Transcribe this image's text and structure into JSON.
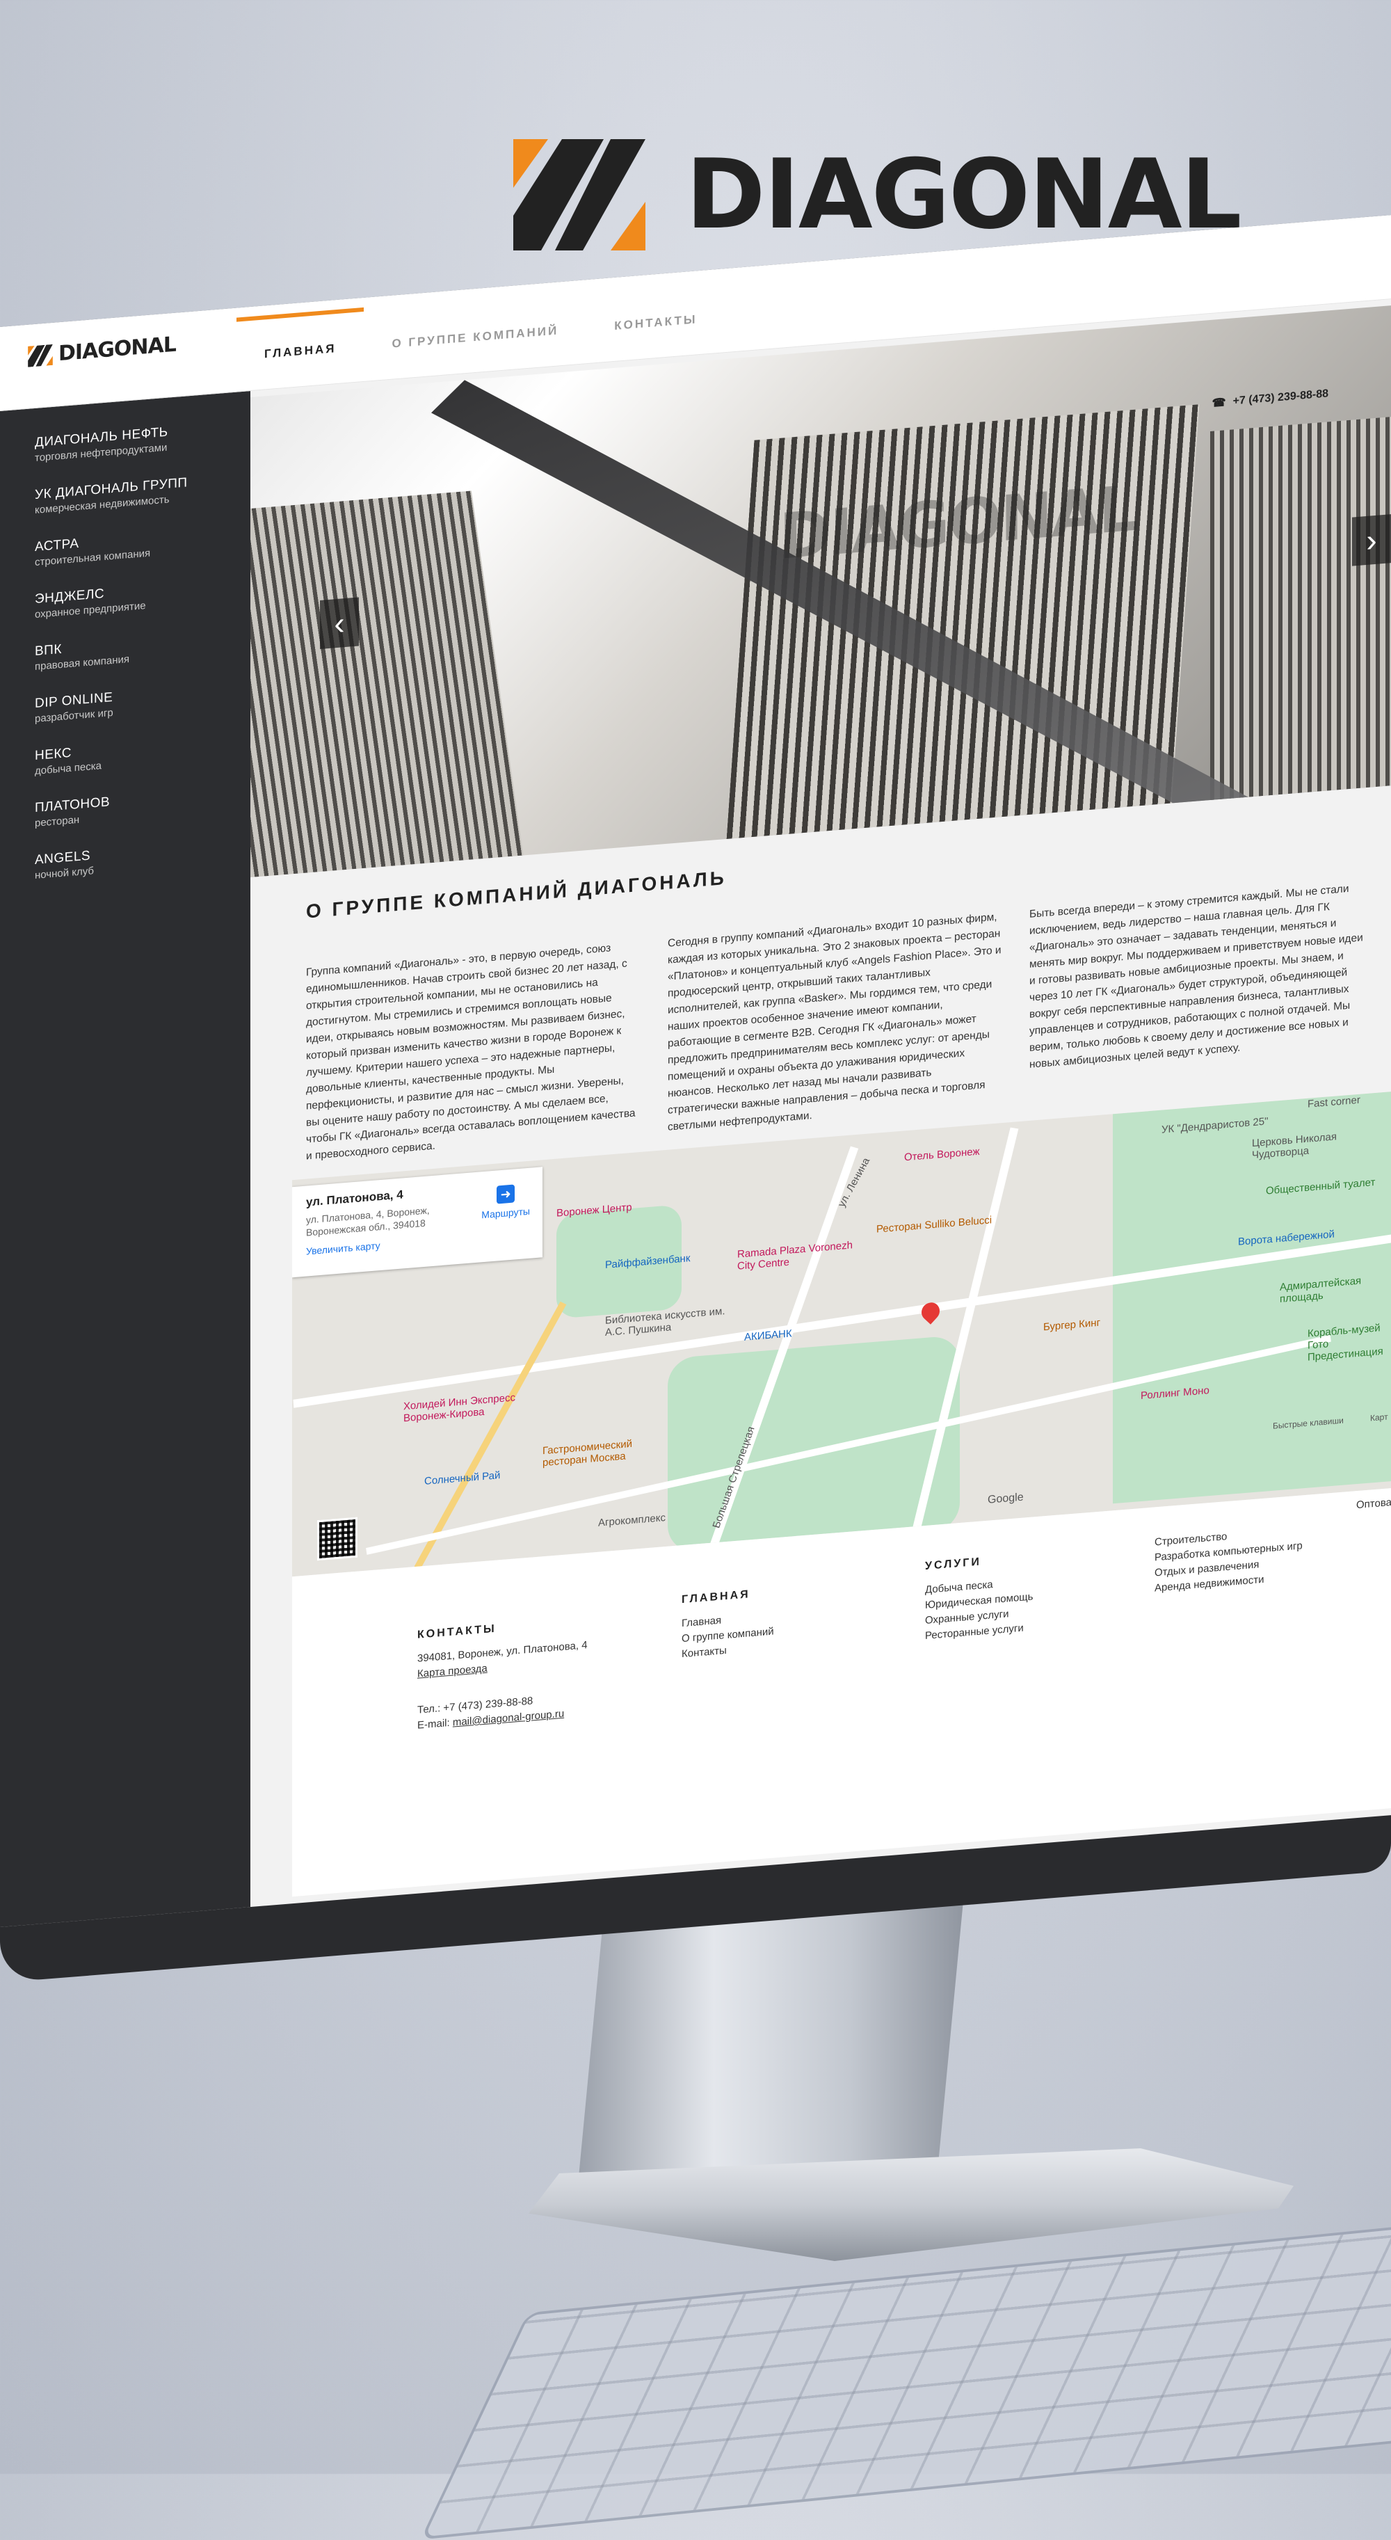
{
  "brand": {
    "name": "DIAGONAL",
    "accent": "#f08a1c"
  },
  "site": {
    "logo_text": "DIAGONAL",
    "nav": [
      {
        "label": "Главная"
      },
      {
        "label": "О группе компаний"
      },
      {
        "label": "Контакты"
      }
    ],
    "phone": "+7 (473) 239-88-88"
  },
  "sidebar": {
    "items": [
      {
        "title": "ДИАГОНАЛЬ НЕФТЬ",
        "subtitle": "торговля нефтепродуктами"
      },
      {
        "title": "УК ДИАГОНАЛЬ ГРУПП",
        "subtitle": "комерческая недвижимость"
      },
      {
        "title": "АСТРА",
        "subtitle": "строительная компания"
      },
      {
        "title": "ЭНДЖЕЛС",
        "subtitle": "охранное предприятие"
      },
      {
        "title": "ВПК",
        "subtitle": "правовая компания"
      },
      {
        "title": "DIP ONLINE",
        "subtitle": "разработчик игр"
      },
      {
        "title": "НЕКС",
        "subtitle": "добыча песка"
      },
      {
        "title": "ПЛАТОНОВ",
        "subtitle": "ресторан"
      },
      {
        "title": "ANGELS",
        "subtitle": "ночной клуб"
      }
    ]
  },
  "hero": {
    "watermark": "DIAGONAL",
    "prev_icon": "chevron-left-icon",
    "next_icon": "chevron-right-icon"
  },
  "about": {
    "title": "О ГРУППЕ КОМПАНИЙ ДИАГОНАЛЬ",
    "col1": "Группа компаний «Диагональ» - это, в первую очередь, союз единомышленников. Начав строить свой бизнес 20 лет назад, с открытия строительной компании, мы не остановились на достигнутом. Мы стремились и стремимся воплощать новые идеи, открываясь новым возможностям. Мы развиваем бизнес, который призван изменить качество жизни в городе Воронеж к лучшему. Критерии нашего успеха – это надежные партнеры, довольные клиенты, качественные продукты. Мы перфекционисты, и развитие для нас – смысл жизни. Уверены, вы оцените нашу работу по достоинству. А мы сделаем все, чтобы ГК «Диагональ» всегда оставалась воплощением качества и превосходного сервиса.",
    "col2": "Сегодня в группу компаний «Диагональ» входит 10 разных фирм, каждая из которых уникальна. Это 2 знаковых проекта – ресторан «Платонов» и концептуальный клуб «Angels Fashion Place». Это и продюсерский центр, открывший таких талантливых исполнителей, как группа «Basker». Мы гордимся тем, что среди наших проектов особенное значение имеют компании, работающие в сегменте B2B. Сегодня ГК «Диагональ» может предложить предпринимателям весь комплекс услуг: от аренды помещений и охраны объекта до улаживания юридических нюансов. Несколько лет назад мы начали развивать стратегически важные направления – добыча песка и торговля светлыми нефтепродуктами.",
    "col3": "Быть всегда впереди – к этому стремится каждый. Мы не стали исключением, ведь лидерство – наша главная цель. Для ГК «Диагональ» это означает – задавать тенденции, меняться и менять мир вокруг. Мы поддерживаем и приветствуем новые идеи и готовы развивать новые амбициозные проекты. Мы знаем, и через 10 лет ГК «Диагональ» будет структурой, объединяющей вокруг себя перспективные направления бизнеса, талантливых управленцев и сотрудников, работающих с полной отдачей. Мы верим, только любовь к своему делу и достижение все новых и новых амбициозных целей ведут к успеху."
  },
  "map": {
    "card": {
      "title": "ул. Платонова, 4",
      "address": "ул. Платонова, 4, Воронеж, Воронежская обл., 394018",
      "enlarge": "Увеличить карту",
      "routes": "Маршруты"
    },
    "labels": {
      "l1": "Воронеж Центр",
      "l2": "Отель Воронеж",
      "l3": "УК \"Дендраристов 25\"",
      "l4": "Райффайзенбанк",
      "l5": "Ramada Plaza Voronezh City Centre",
      "l6": "Ресторан Sulliko Belucci",
      "l7": "Библиотека искусств им. А.С. Пушкина",
      "l8": "АКИБАНК",
      "l9": "Бургер Кинг",
      "l10": "Холидей Инн Экспресс Воронеж-Кирова",
      "l11": "Гастрономический ресторан Москва",
      "l12": "Солнечный Рай",
      "l13": "Агрокомплекс",
      "l14": "Роллинг Моно",
      "l15": "Адмиралтейская площадь",
      "l16": "Ворота набережной",
      "l17": "Церковь Николая Чудотворца",
      "l18": "Общественный туалет",
      "l19": "Fast corner",
      "l20": "Корабль-музей Гото Предестинация",
      "l21": "ул. Ленина",
      "l22": "Большая Стрелецкая",
      "l23": "Быстрые клавиши",
      "l24": "Карт"
    },
    "google": "Google"
  },
  "footer": {
    "contacts": {
      "title": "КОНТАКТЫ",
      "address": "394081, Воронеж, ул. Платонова, 4",
      "map_link": "Карта проезда",
      "phone": "Тел.: +7 (473) 239-88-88",
      "email_label": "E-mail:",
      "email": "mail@diagonal-group.ru"
    },
    "main": {
      "title": "ГЛАВНАЯ",
      "links": [
        "Главная",
        "О группе компаний",
        "Контакты"
      ]
    },
    "services": {
      "title": "УСЛУГИ",
      "links": [
        "Добыча песка",
        "Юридическая помощь",
        "Охранные услуги",
        "Ресторанные услуги"
      ]
    },
    "more": {
      "links": [
        "Строительство",
        "Разработка компьютерных игр",
        "Отдых и развлечения",
        "Аренда недвижимости"
      ]
    },
    "extra": "Оптовая"
  }
}
